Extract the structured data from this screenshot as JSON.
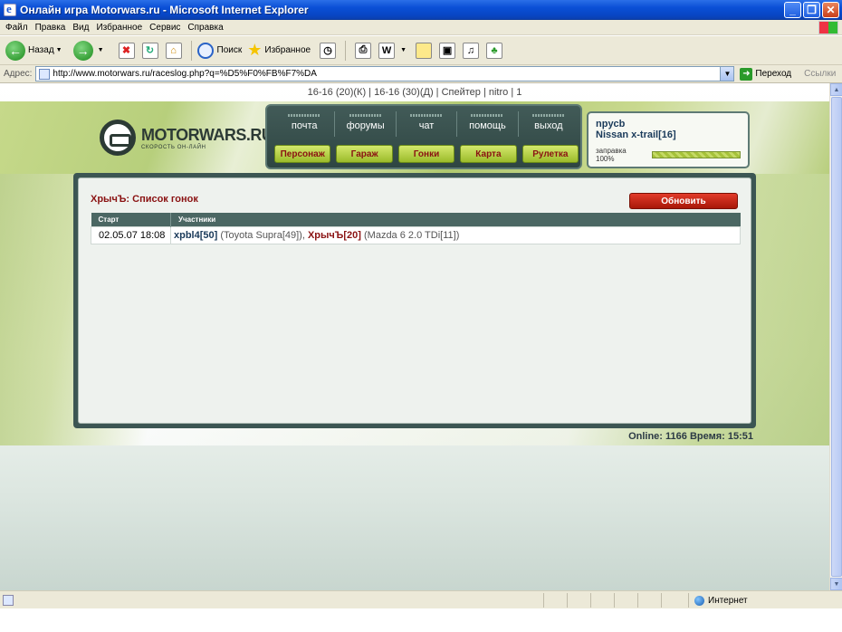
{
  "window": {
    "title": "Онлайн игра Motorwars.ru - Microsoft Internet Explorer",
    "btn_minimize": "_",
    "btn_maximize": "❐",
    "btn_close": "✕"
  },
  "menu": [
    "Файл",
    "Правка",
    "Вид",
    "Избранное",
    "Сервис",
    "Справка"
  ],
  "toolbar": {
    "back": "Назад",
    "search": "Поиск",
    "favorites": "Избранное"
  },
  "address": {
    "label": "Адрес:",
    "url": "http://www.motorwars.ru/raceslog.php?q=%D5%F0%FB%F7%DA",
    "go": "Переход",
    "links": "Ссылки"
  },
  "site": {
    "topline": "16-16 (20)(К) | 16-16 (30)(Д) | Спейтер | nitro | 1",
    "logo_name": "MOTORWARS.RU",
    "logo_sub": "СКОРОСТЬ ОН-ЛАЙН",
    "nav_top": [
      "почта",
      "форумы",
      "чат",
      "помощь",
      "выход"
    ],
    "nav_bottom": [
      "Персонаж",
      "Гараж",
      "Гонки",
      "Карта",
      "Рулетка"
    ],
    "user": {
      "name": "npycb",
      "car": "Nissan x-trail[16]",
      "fuel_label": "заправка 100%",
      "fuel_level": 1.0
    },
    "main": {
      "title": "ХрычЪ: Список гонок",
      "refresh": "Обновить",
      "columns": [
        "Старт",
        "Участники"
      ],
      "rows": [
        {
          "start": "02.05.07 18:08",
          "p1": "xpbl4[50]",
          "p1_car": " (Toyota Supra[49]), ",
          "p2": "ХрычЪ[20]",
          "p2_car": " (Mazda 6 2.0 TDi[11])"
        }
      ]
    },
    "online": "Online: 1166   Время: 15:51"
  },
  "status": {
    "zone": "Интернет"
  },
  "colors": {
    "accent_red": "#8a1212",
    "panel_dark": "#3c5653",
    "button_green": "#9bbb2a"
  }
}
